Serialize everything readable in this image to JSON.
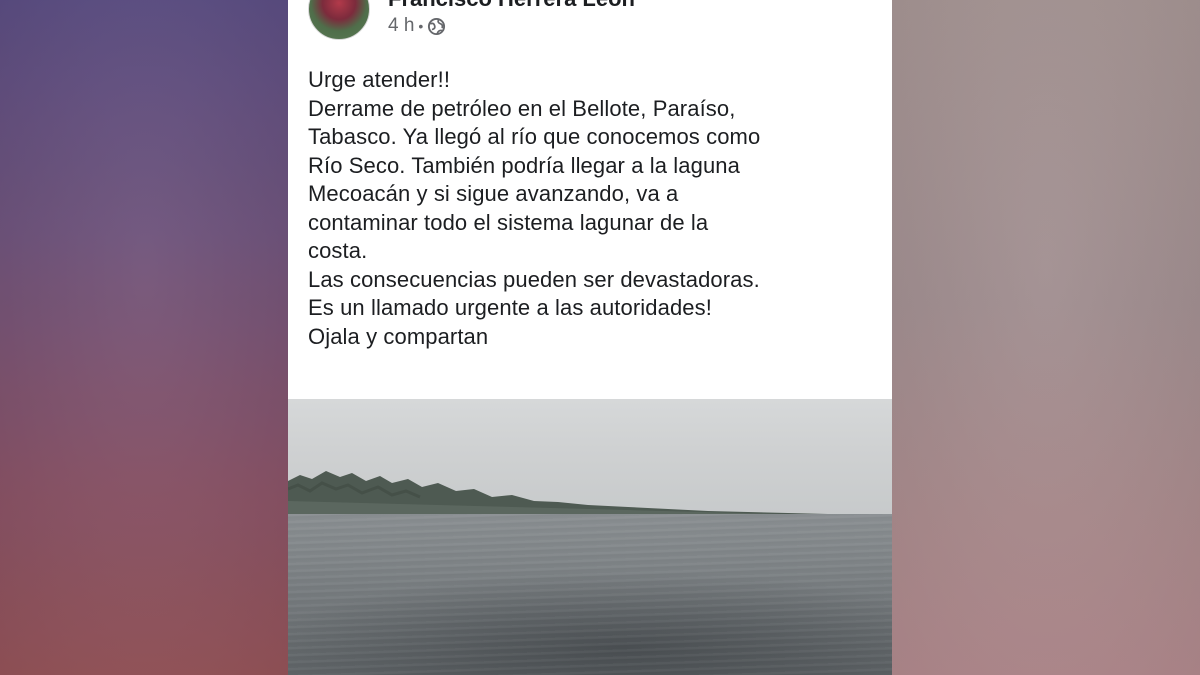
{
  "post": {
    "author": "Francisco Herrera León",
    "time": "4 h",
    "separator": "•",
    "privacy_icon": "globe-icon",
    "text_lines": [
      "Urge atender!!",
      "Derrame de petróleo en el Bellote, Paraíso,",
      "Tabasco. Ya llegó al río que conocemos como",
      "Río Seco. También podría llegar a la laguna",
      "Mecoacán y si sigue avanzando, va a",
      "contaminar todo el sistema lagunar de la",
      "costa.",
      "Las consecuencias pueden ser devastadoras.",
      "Es un llamado urgente a las autoridades!",
      "Ojala y compartan"
    ]
  },
  "colors": {
    "card_background": "#ffffff",
    "text_primary": "#1c1e21",
    "text_secondary": "#65676b"
  }
}
